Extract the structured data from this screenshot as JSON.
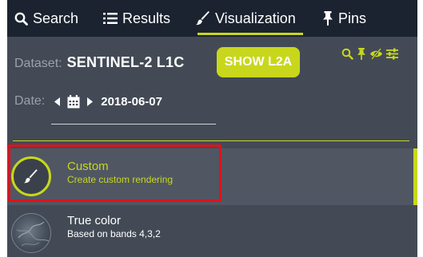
{
  "tabs": [
    {
      "label": "Search",
      "icon": "search-icon"
    },
    {
      "label": "Results",
      "icon": "list-icon"
    },
    {
      "label": "Visualization",
      "icon": "brush-icon",
      "active": true
    },
    {
      "label": "Pins",
      "icon": "pin-icon"
    }
  ],
  "dataset": {
    "label": "Dataset:",
    "value": "SENTINEL-2 L1C",
    "button": "SHOW L2A"
  },
  "toolbar": {
    "icons": [
      "search-icon",
      "pin-icon",
      "eye-slash-icon",
      "sliders-icon"
    ]
  },
  "date": {
    "label": "Date:",
    "value": "2018-06-07"
  },
  "layers": [
    {
      "title": "Custom",
      "subtitle": "Create custom rendering",
      "selected": true
    },
    {
      "title": "True color",
      "subtitle": "Based on bands 4,3,2"
    }
  ],
  "colors": {
    "accent": "#c8d71c",
    "nav_bg": "#1b2330",
    "panel_bg": "#434a55",
    "highlight": "#e0121b"
  }
}
